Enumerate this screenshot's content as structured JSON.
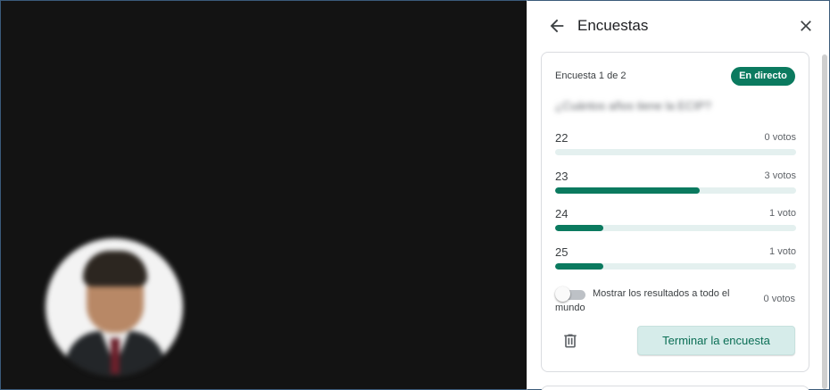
{
  "panel": {
    "title": "Encuestas"
  },
  "poll": {
    "count_label": "Encuesta 1 de 2",
    "status_badge": "En directo",
    "question": "¿Cuántos años tiene la ECIP?",
    "options": [
      {
        "label": "22",
        "votes_label": "0 votos",
        "fraction": 0.0
      },
      {
        "label": "23",
        "votes_label": "3 votos",
        "fraction": 0.6
      },
      {
        "label": "24",
        "votes_label": "1 voto",
        "fraction": 0.2
      },
      {
        "label": "25",
        "votes_label": "1 voto",
        "fraction": 0.2
      }
    ],
    "show_results_label": "Mostrar los resultados a todo el mundo",
    "show_results_enabled": false,
    "show_results_votes": "0 votos",
    "end_button": "Terminar la encuesta"
  },
  "colors": {
    "accent": "#0b7a5f",
    "track": "#e4f0ef",
    "end_button_bg": "#d6ecea",
    "video_bg": "#131313"
  },
  "icons": {
    "back": "arrow-left-icon",
    "close": "close-icon",
    "delete": "trash-icon"
  }
}
